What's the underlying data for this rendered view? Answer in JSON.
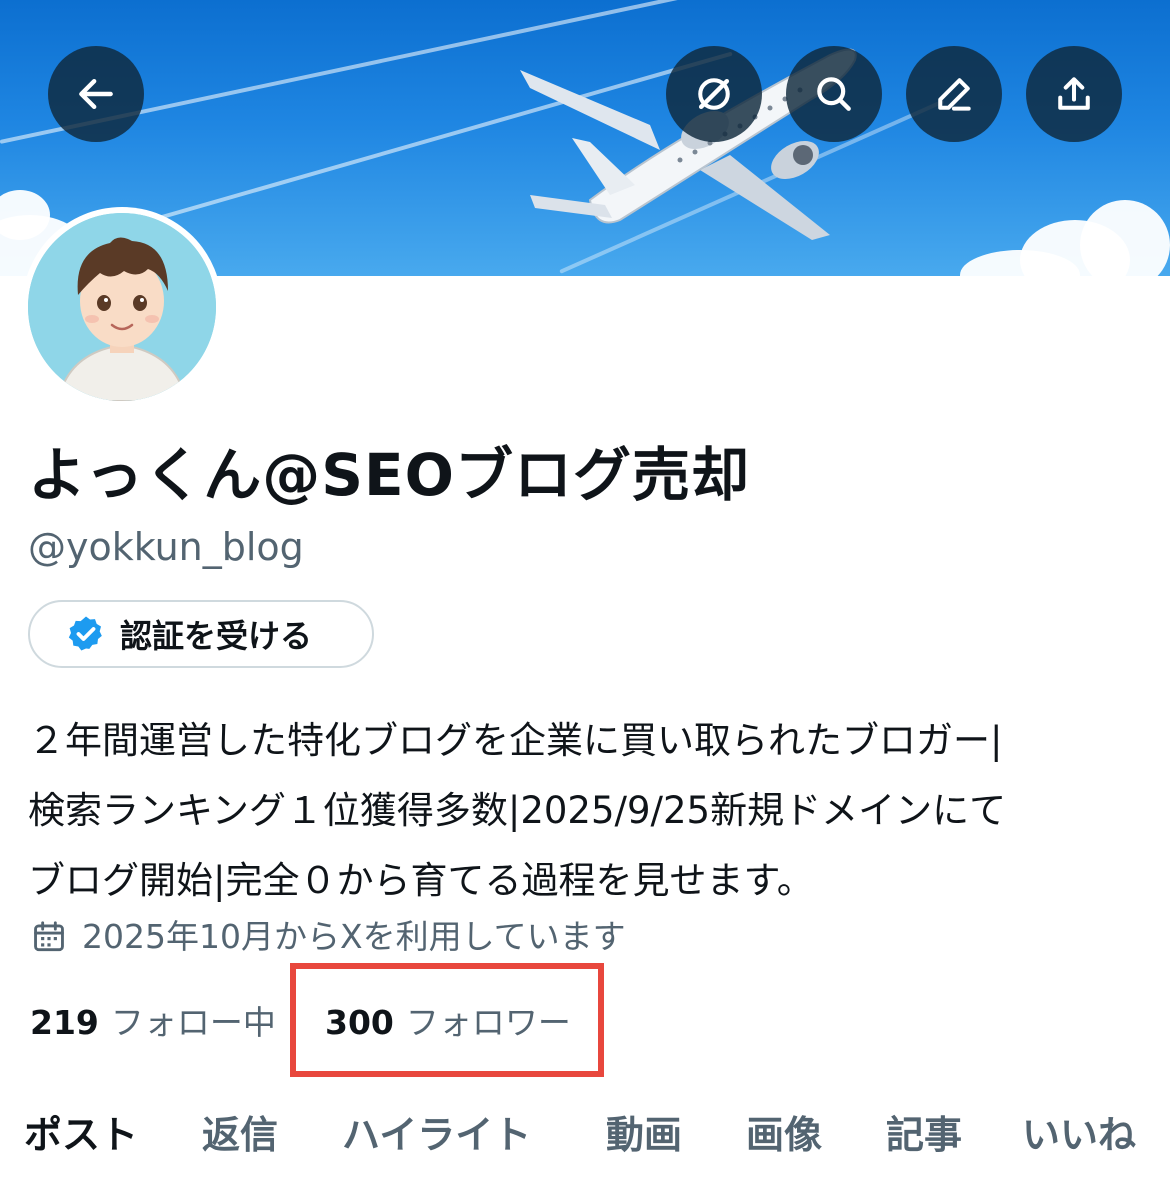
{
  "header": {
    "back_icon": "arrow-left-icon",
    "actions": [
      {
        "name": "grok-icon"
      },
      {
        "name": "search-icon"
      },
      {
        "name": "edit-icon"
      },
      {
        "name": "share-icon"
      }
    ]
  },
  "profile": {
    "display_name": "よっくん@SEOブログ売却",
    "handle": "@yokkun_blog",
    "verify_button": "認証を受ける",
    "bio_lines": [
      "２年間運営した特化ブログを企業に買い取られたブロガー|",
      "検索ランキング１位獲得多数|2025/9/25新規ドメインにて",
      "ブログ開始|完全０から育てる過程を見せます。"
    ],
    "joined": "2025年10月からXを利用しています",
    "following_count": "219",
    "following_label": "フォロー中",
    "followers_count": "300",
    "followers_label": "フォロワー"
  },
  "tabs": [
    "ポスト",
    "返信",
    "ハイライト",
    "動画",
    "画像",
    "記事",
    "いいね"
  ],
  "colors": {
    "accent": "#1d9bf0",
    "highlight": "#e8473d",
    "muted_text": "#536471"
  }
}
